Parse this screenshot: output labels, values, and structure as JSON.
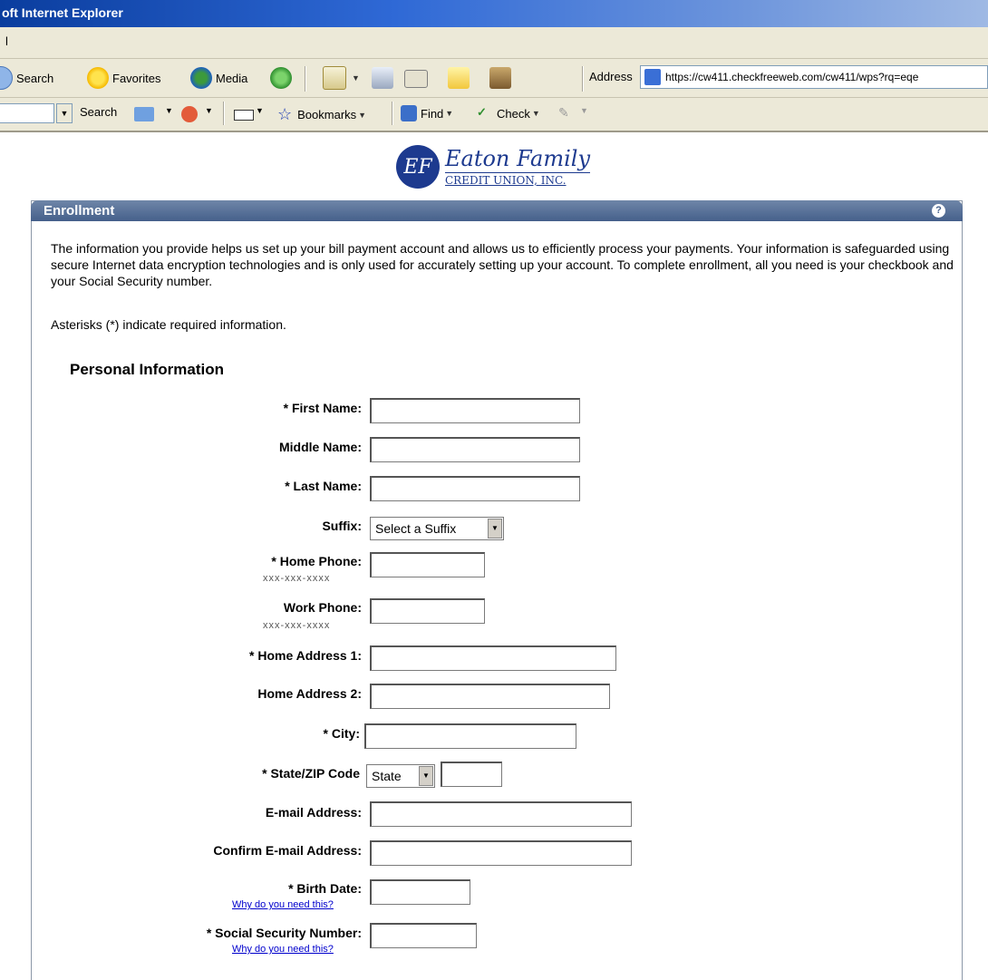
{
  "window": {
    "title": "oft Internet Explorer"
  },
  "menu": {
    "fragment": "l"
  },
  "toolbar": {
    "search_label": "Search",
    "favorites_label": "Favorites",
    "media_label": "Media",
    "address_label": "Address",
    "address_url": "https://cw411.checkfreeweb.com/cw411/wps?rq=eqe"
  },
  "toolbar2": {
    "search_label": "Search",
    "bookmarks_label": "Bookmarks",
    "find_label": "Find",
    "check_label": "Check"
  },
  "logo": {
    "monogram": "EF",
    "name": "Eaton Family",
    "subtitle": "CREDIT UNION, INC."
  },
  "panel": {
    "title": "Enrollment",
    "help": "?",
    "intro": "The information you provide helps us set up your bill payment account and allows us to efficiently process your payments. Your information is safeguarded using secure Internet data encryption technologies and is only used for accurately setting up your account. To complete enrollment, all you need is your checkbook and your Social Security number.",
    "required_note": "Asterisks (*) indicate required information.",
    "section_title": "Personal Information"
  },
  "form": {
    "first_name": "* First Name:",
    "middle_name": "Middle Name:",
    "last_name": "* Last Name:",
    "suffix": "Suffix:",
    "suffix_selected": "Select a Suffix",
    "home_phone": "* Home Phone:",
    "home_phone_hint": "xxx-xxx-xxxx",
    "work_phone": "Work Phone:",
    "work_phone_hint": "xxx-xxx-xxxx",
    "home_address_1": "* Home Address 1:",
    "home_address_2": "Home Address 2:",
    "city": "* City:",
    "state_zip": "* State/ZIP Code",
    "state_selected": "State",
    "email": "E-mail Address:",
    "confirm_email": "Confirm E-mail Address:",
    "birth_date": "* Birth Date:",
    "birth_why": "Why do you need this?",
    "ssn": "* Social Security Number:",
    "ssn_why": "Why do you need this?"
  },
  "colors": {
    "panel_header": "#45608b",
    "titlebar": "#0a3d9e",
    "chrome": "#ece9d8",
    "link": "#0000cc"
  }
}
